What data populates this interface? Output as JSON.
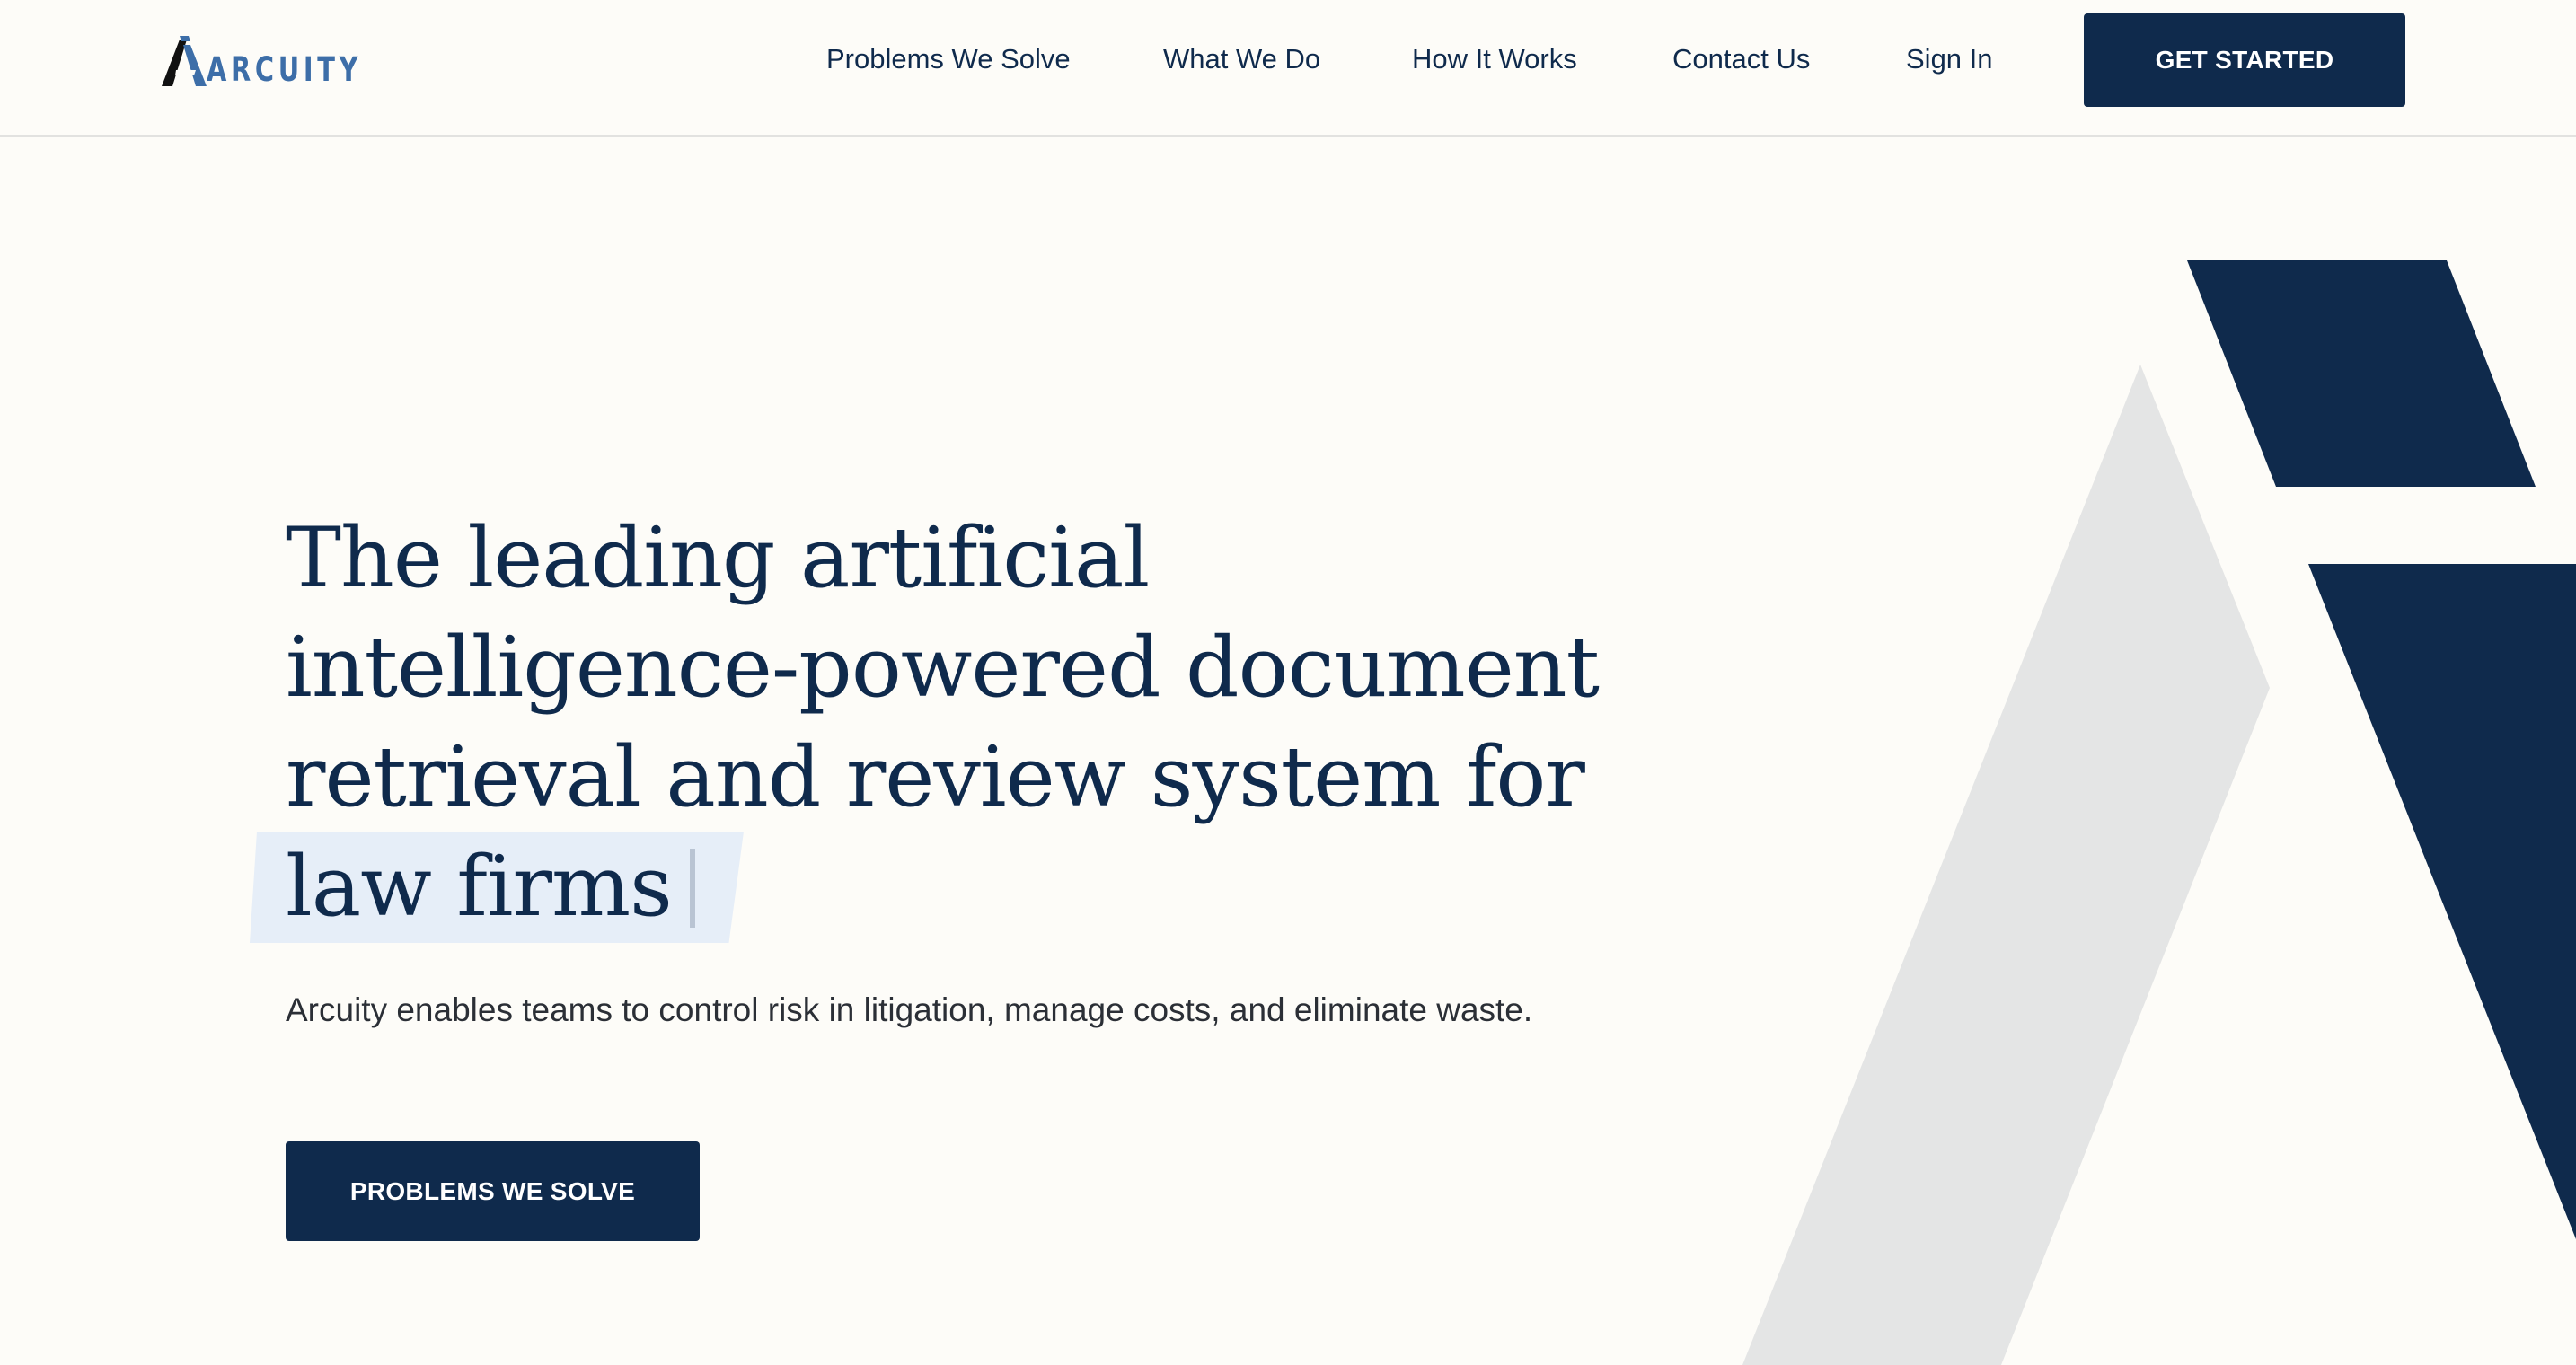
{
  "brand": {
    "name": "ARCUITY",
    "icon": "arcuity-a-logo",
    "accent_color": "#3d6ea8",
    "navy_color": "#0f2a4c"
  },
  "nav": {
    "items": [
      {
        "label": "Problems We Solve"
      },
      {
        "label": "What We Do"
      },
      {
        "label": "How It Works"
      },
      {
        "label": "Contact Us"
      },
      {
        "label": "Sign In"
      }
    ],
    "cta_label": "GET STARTED"
  },
  "hero": {
    "heading_lines": [
      "The leading artificial",
      "intelligence-powered document",
      "retrieval and review system for"
    ],
    "highlight": "law firms",
    "subtitle": "Arcuity enables teams to control risk in litigation, manage costs, and eliminate waste.",
    "button_label": "PROBLEMS WE SOLVE"
  }
}
